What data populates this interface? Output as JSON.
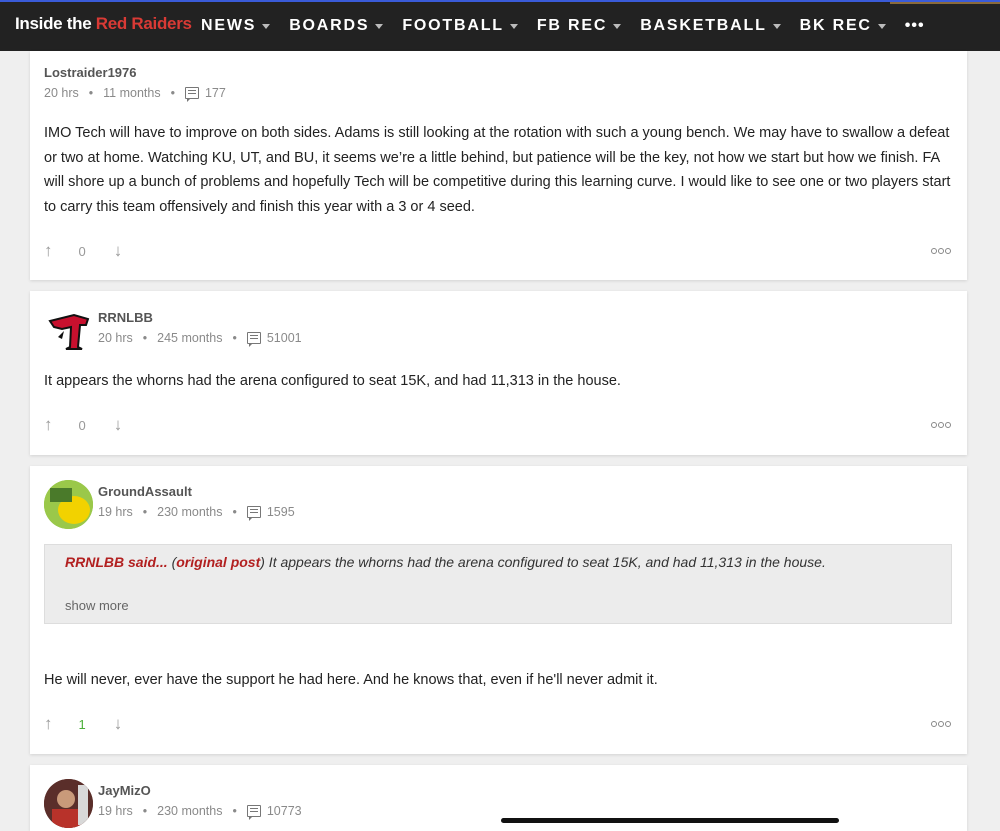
{
  "header": {
    "logo_prefix": "Inside the ",
    "logo_highlight": "Red Raiders",
    "nav": [
      {
        "label": "NEWS"
      },
      {
        "label": "BOARDS"
      },
      {
        "label": "FOOTBALL"
      },
      {
        "label": "FB REC"
      },
      {
        "label": "BASKETBALL"
      },
      {
        "label": "BK REC"
      }
    ],
    "more": "•••"
  },
  "posts": [
    {
      "username": "Lostraider1976",
      "time": "20 hrs",
      "tenure": "11 months",
      "post_count": "177",
      "body": "IMO Tech will have to improve on both sides. Adams is still looking at the rotation with such a young bench. We may have to swallow a defeat or two at home. Watching KU, UT, and BU, it seems we’re a little behind, but patience will be the key, not how we start but how we finish. FA will shore up a bunch of problems and hopefully Tech will be competitive during this learning curve. I would like to see one or two players start to carry this team offensively and finish this year with a 3 or 4 seed.",
      "votes": "0"
    },
    {
      "username": "RRNLBB",
      "time": "20 hrs",
      "tenure": "245 months",
      "post_count": "51001",
      "body": "It appears the whorns had the arena configured to seat 15K, and had 11,313 in the house.",
      "votes": "0"
    },
    {
      "username": "GroundAssault",
      "time": "19 hrs",
      "tenure": "230 months",
      "post_count": "1595",
      "quote": {
        "author": "RRNLBB said...",
        "open_paren": " (",
        "link": "original post",
        "text": ") It appears the whorns had the arena configured to seat 15K, and had 11,313 in the house.",
        "show_more": "show more"
      },
      "body": "He will never, ever have the support he had here. And he knows that, even if he'll never admit it.",
      "votes": "1"
    },
    {
      "username": "JayMizO",
      "time": "19 hrs",
      "tenure": "230 months",
      "post_count": "10773"
    }
  ],
  "meta_separator": "•",
  "colors": {
    "brand_red": "#d93a35",
    "positive_vote": "#4cae3a",
    "nav_bg": "#222222"
  }
}
